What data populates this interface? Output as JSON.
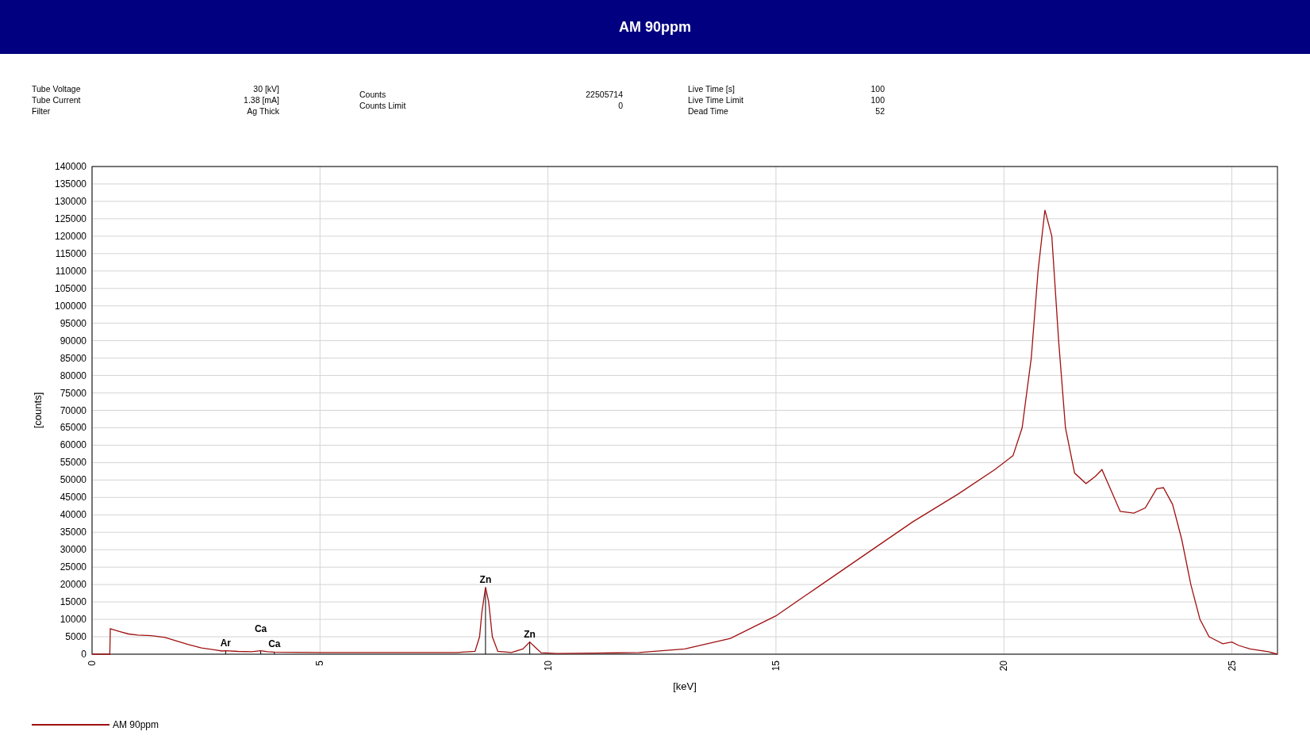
{
  "title": "AM 90ppm",
  "info_groups": [
    {
      "rows": [
        {
          "label": "Tube Voltage",
          "value": "30 [kV]"
        },
        {
          "label": "Tube Current",
          "value": "1.38 [mA]"
        },
        {
          "label": "Filter",
          "value": "Ag Thick"
        }
      ]
    },
    {
      "rows": [
        {
          "label": "Counts",
          "value": "22505714"
        },
        {
          "label": "Counts Limit",
          "value": "0"
        }
      ]
    },
    {
      "rows": [
        {
          "label": "Live Time [s]",
          "value": "100"
        },
        {
          "label": "Live Time Limit",
          "value": "100"
        },
        {
          "label": "Dead Time",
          "value": "52"
        }
      ]
    }
  ],
  "chart": {
    "chart_data": {
      "type": "line",
      "xlabel": "[keV]",
      "ylabel": "[counts]",
      "xlim": [
        0,
        26
      ],
      "ylim": [
        0,
        140000
      ],
      "xticks": [
        0,
        5,
        10,
        15,
        20,
        25
      ],
      "yticks": [
        0,
        5000,
        10000,
        15000,
        20000,
        25000,
        30000,
        35000,
        40000,
        45000,
        50000,
        55000,
        60000,
        65000,
        70000,
        75000,
        80000,
        85000,
        90000,
        95000,
        100000,
        105000,
        110000,
        115000,
        120000,
        125000,
        130000,
        135000,
        140000
      ],
      "grid": true,
      "x": [
        0,
        0.39,
        0.4,
        0.6,
        0.8,
        1.0,
        1.3,
        1.6,
        1.8,
        2.1,
        2.4,
        2.7,
        2.85,
        2.93,
        3.2,
        3.5,
        3.7,
        3.85,
        4.0,
        5,
        6,
        7,
        8,
        8.4,
        8.5,
        8.55,
        8.63,
        8.7,
        8.78,
        8.9,
        9.2,
        9.45,
        9.6,
        9.72,
        9.85,
        10.2,
        11,
        12,
        13,
        14,
        15,
        16,
        17,
        18,
        19,
        19.8,
        20.2,
        20.4,
        20.6,
        20.75,
        20.9,
        21.05,
        21.2,
        21.35,
        21.55,
        21.8,
        22.0,
        22.15,
        22.35,
        22.55,
        22.85,
        23.1,
        23.35,
        23.5,
        23.7,
        23.9,
        24.1,
        24.3,
        24.5,
        24.8,
        25,
        25.15,
        25.4,
        25.8,
        26
      ],
      "series": [
        {
          "name": "AM 90ppm",
          "color": "#a01010",
          "values": [
            0,
            0,
            7300,
            6500,
            5800,
            5500,
            5300,
            4800,
            4000,
            2800,
            1800,
            1200,
            900,
            1000,
            800,
            700,
            1000,
            700,
            600,
            500,
            500,
            500,
            500,
            800,
            5000,
            12000,
            19200,
            15000,
            5000,
            800,
            500,
            1500,
            3500,
            2000,
            400,
            200,
            300,
            500,
            1500,
            4500,
            11000,
            20000,
            29000,
            38000,
            46000,
            53000,
            57000,
            65000,
            85000,
            110000,
            127500,
            120000,
            90000,
            65000,
            52000,
            49000,
            51000,
            53000,
            47000,
            41000,
            40500,
            42000,
            47500,
            47800,
            43000,
            33000,
            20000,
            10000,
            5000,
            3000,
            3500,
            2500,
            1500,
            700,
            0
          ]
        }
      ],
      "annotations": [
        {
          "x": 2.93,
          "y": 1000,
          "text": "Ar"
        },
        {
          "x": 3.7,
          "y": 1000,
          "text": "Ca"
        },
        {
          "x": 4.0,
          "y": 600,
          "text": "Ca"
        },
        {
          "x": 8.63,
          "y": 19200,
          "text": "Zn"
        },
        {
          "x": 9.6,
          "y": 3500,
          "text": "Zn"
        }
      ]
    }
  }
}
